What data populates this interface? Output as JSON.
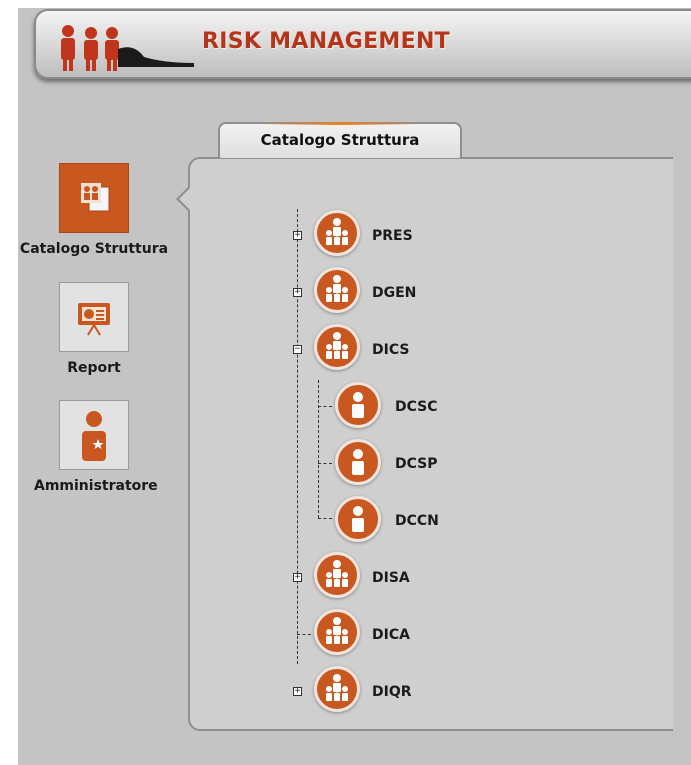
{
  "header": {
    "title": "RISK MANAGEMENT",
    "logo_icon": "people-logo-icon"
  },
  "colors": {
    "accent": "#c8581f",
    "title": "#b5341a",
    "background": "#c4c4c4"
  },
  "nav": [
    {
      "label": "Catalogo Struttura",
      "icon": "organization-icon",
      "active": true
    },
    {
      "label": "Report",
      "icon": "presentation-icon",
      "active": false
    },
    {
      "label": "Amministratore",
      "icon": "admin-user-icon",
      "active": false
    }
  ],
  "panel": {
    "tab_label": "Catalogo Struttura"
  },
  "tree": [
    {
      "label": "PRES",
      "level": 0,
      "expander": "plus"
    },
    {
      "label": "DGEN",
      "level": 0,
      "expander": "plus"
    },
    {
      "label": "DICS",
      "level": 0,
      "expander": "minus"
    },
    {
      "label": "DCSC",
      "level": 1,
      "expander": "none"
    },
    {
      "label": "DCSP",
      "level": 1,
      "expander": "none"
    },
    {
      "label": "DCCN",
      "level": 1,
      "expander": "none"
    },
    {
      "label": "DISA",
      "level": 0,
      "expander": "plus"
    },
    {
      "label": "DICA",
      "level": 0,
      "expander": "none"
    },
    {
      "label": "DIQR",
      "level": 0,
      "expander": "plus"
    }
  ]
}
